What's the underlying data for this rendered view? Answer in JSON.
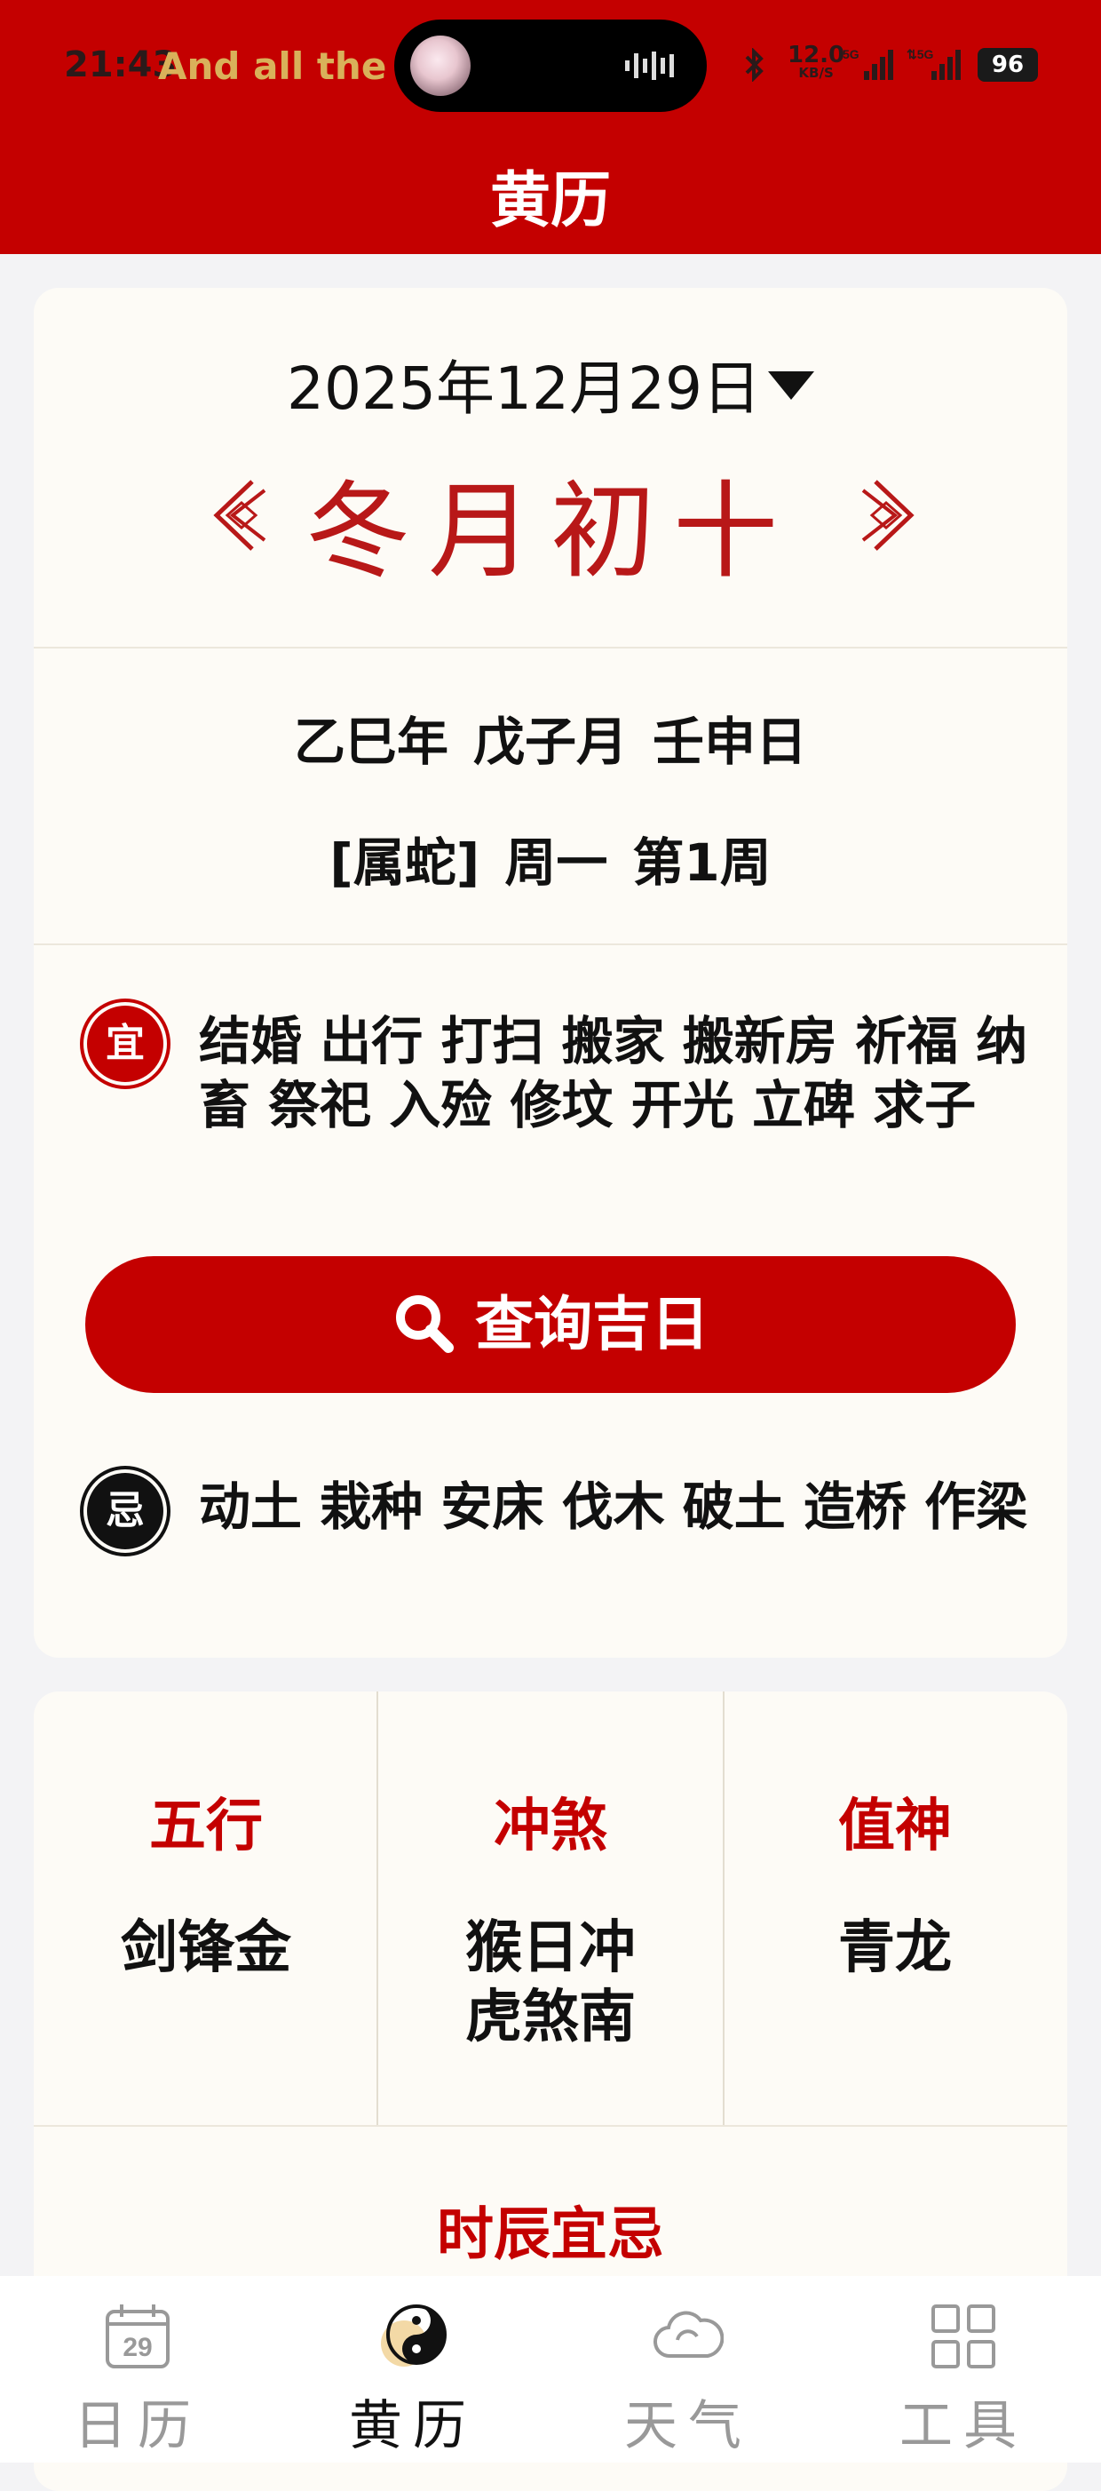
{
  "status_bar": {
    "time": "21:43",
    "song": "And all the o",
    "speed_value": "12.0",
    "speed_unit": "KB/S",
    "battery": "96"
  },
  "header": {
    "title": "黄历"
  },
  "date_card": {
    "date": "2025年12月29日",
    "lunar_date": "冬月初十",
    "ganzhi": {
      "year": "乙巳年",
      "month": "戊子月",
      "day": "壬申日"
    },
    "zodiac": "[属蛇]",
    "weekday": "周一",
    "week_no": "第1周",
    "yi_badge": "宜",
    "yi_items": "结婚 出行 打扫 搬家 搬新房 祈福 纳畜 祭祀 入殓 修坟 开光 立碑 求子",
    "query_button": "查询吉日",
    "ji_badge": "忌",
    "ji_items": "动土 栽种 安床 伐木 破土 造桥 作梁"
  },
  "info_card": {
    "columns": [
      {
        "head": "五行",
        "value": "剑锋金"
      },
      {
        "head": "冲煞",
        "value": "猴日冲虎煞南"
      },
      {
        "head": "值神",
        "value": "青龙"
      }
    ],
    "hour_title": "时辰宜忌"
  },
  "tabbar": {
    "items": [
      {
        "label": "日历",
        "icon": "calendar-icon",
        "badge": "29"
      },
      {
        "label": "黄历",
        "icon": "yinyang-icon"
      },
      {
        "label": "天气",
        "icon": "cloud-icon"
      },
      {
        "label": "工具",
        "icon": "grid-icon"
      }
    ],
    "active": "黄历"
  },
  "colors": {
    "primary_red": "#c40000",
    "card_bg": "#fdfbf6",
    "page_bg": "#f3f3f5"
  }
}
